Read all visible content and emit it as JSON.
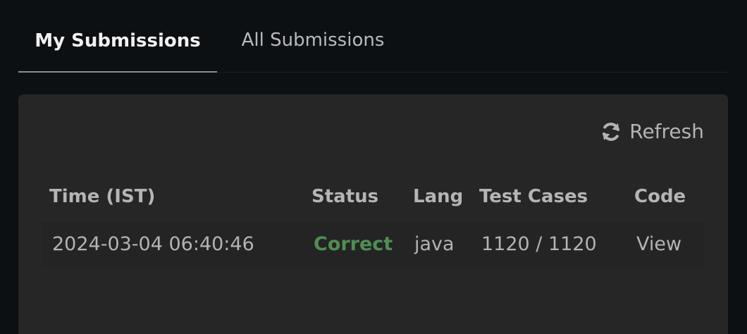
{
  "tabs": [
    {
      "label": "My Submissions",
      "active": true
    },
    {
      "label": "All Submissions",
      "active": false
    }
  ],
  "panel": {
    "refresh_label": "Refresh",
    "refresh_icon": "refresh-icon"
  },
  "table": {
    "headers": {
      "time": "Time (IST)",
      "status": "Status",
      "lang": "Lang",
      "test_cases": "Test Cases",
      "code": "Code"
    },
    "rows": [
      {
        "time": "2024-03-04 06:40:46",
        "status": "Correct",
        "lang": "java",
        "test_cases": "1120 / 1120",
        "code": "View"
      }
    ]
  },
  "colors": {
    "background": "#0d1013",
    "panel": "#262626",
    "status_correct": "#4e8e53",
    "text_muted": "#b3b3b3",
    "text_active": "#f2f2f2"
  }
}
